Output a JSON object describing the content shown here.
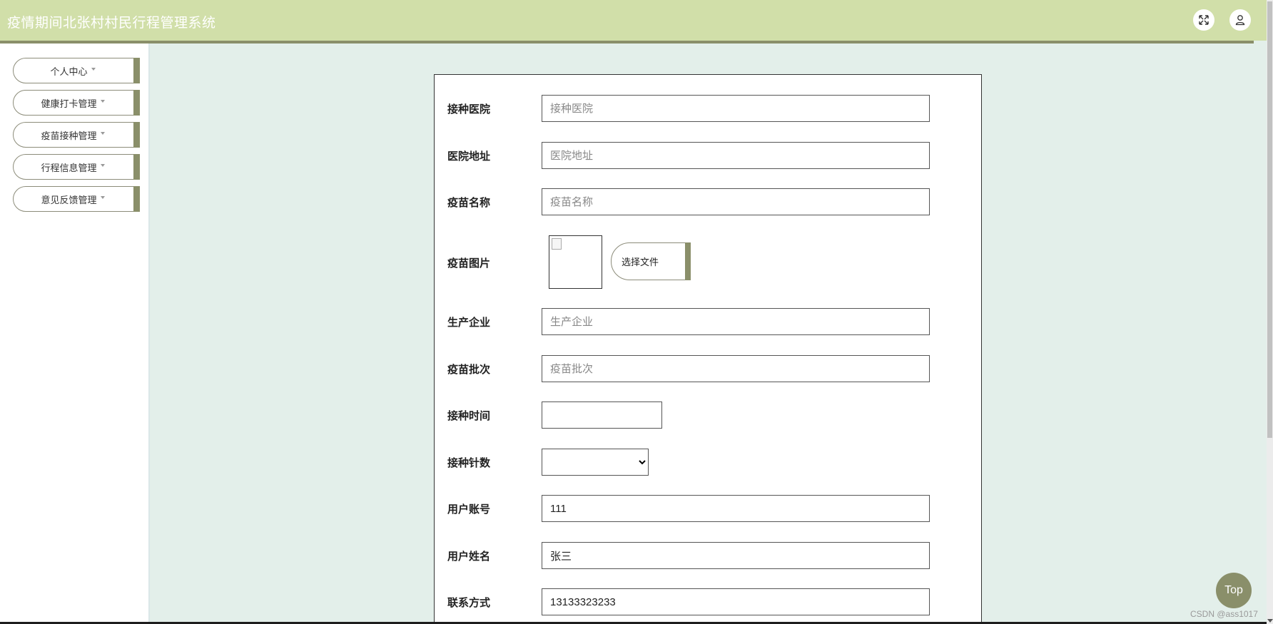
{
  "header": {
    "title": "疫情期间北张村村民行程管理系统",
    "fullscreen_icon": "expand-arrows-icon",
    "user_icon": "user-icon"
  },
  "sidebar": {
    "items": [
      {
        "label": "个人中心"
      },
      {
        "label": "健康打卡管理"
      },
      {
        "label": "疫苗接种管理"
      },
      {
        "label": "行程信息管理"
      },
      {
        "label": "意见反馈管理"
      }
    ]
  },
  "form": {
    "hospital": {
      "label": "接种医院",
      "placeholder": "接种医院",
      "value": ""
    },
    "hospital_address": {
      "label": "医院地址",
      "placeholder": "医院地址",
      "value": ""
    },
    "vaccine_name": {
      "label": "疫苗名称",
      "placeholder": "疫苗名称",
      "value": ""
    },
    "vaccine_image": {
      "label": "疫苗图片",
      "upload_button": "选择文件"
    },
    "manufacturer": {
      "label": "生产企业",
      "placeholder": "生产企业",
      "value": ""
    },
    "batch": {
      "label": "疫苗批次",
      "placeholder": "疫苗批次",
      "value": ""
    },
    "vaccination_time": {
      "label": "接种时间",
      "value": ""
    },
    "dose_count": {
      "label": "接种针数",
      "selected": ""
    },
    "account": {
      "label": "用户账号",
      "value": "111"
    },
    "user_name": {
      "label": "用户姓名",
      "value": "张三"
    },
    "contact": {
      "label": "联系方式",
      "value": "13133323233"
    }
  },
  "top_button": "Top",
  "watermark": "CSDN @ass1017",
  "colors": {
    "header_bg": "#d1dfa9",
    "accent": "#8a8f6a",
    "content_bg": "#e3efea"
  }
}
